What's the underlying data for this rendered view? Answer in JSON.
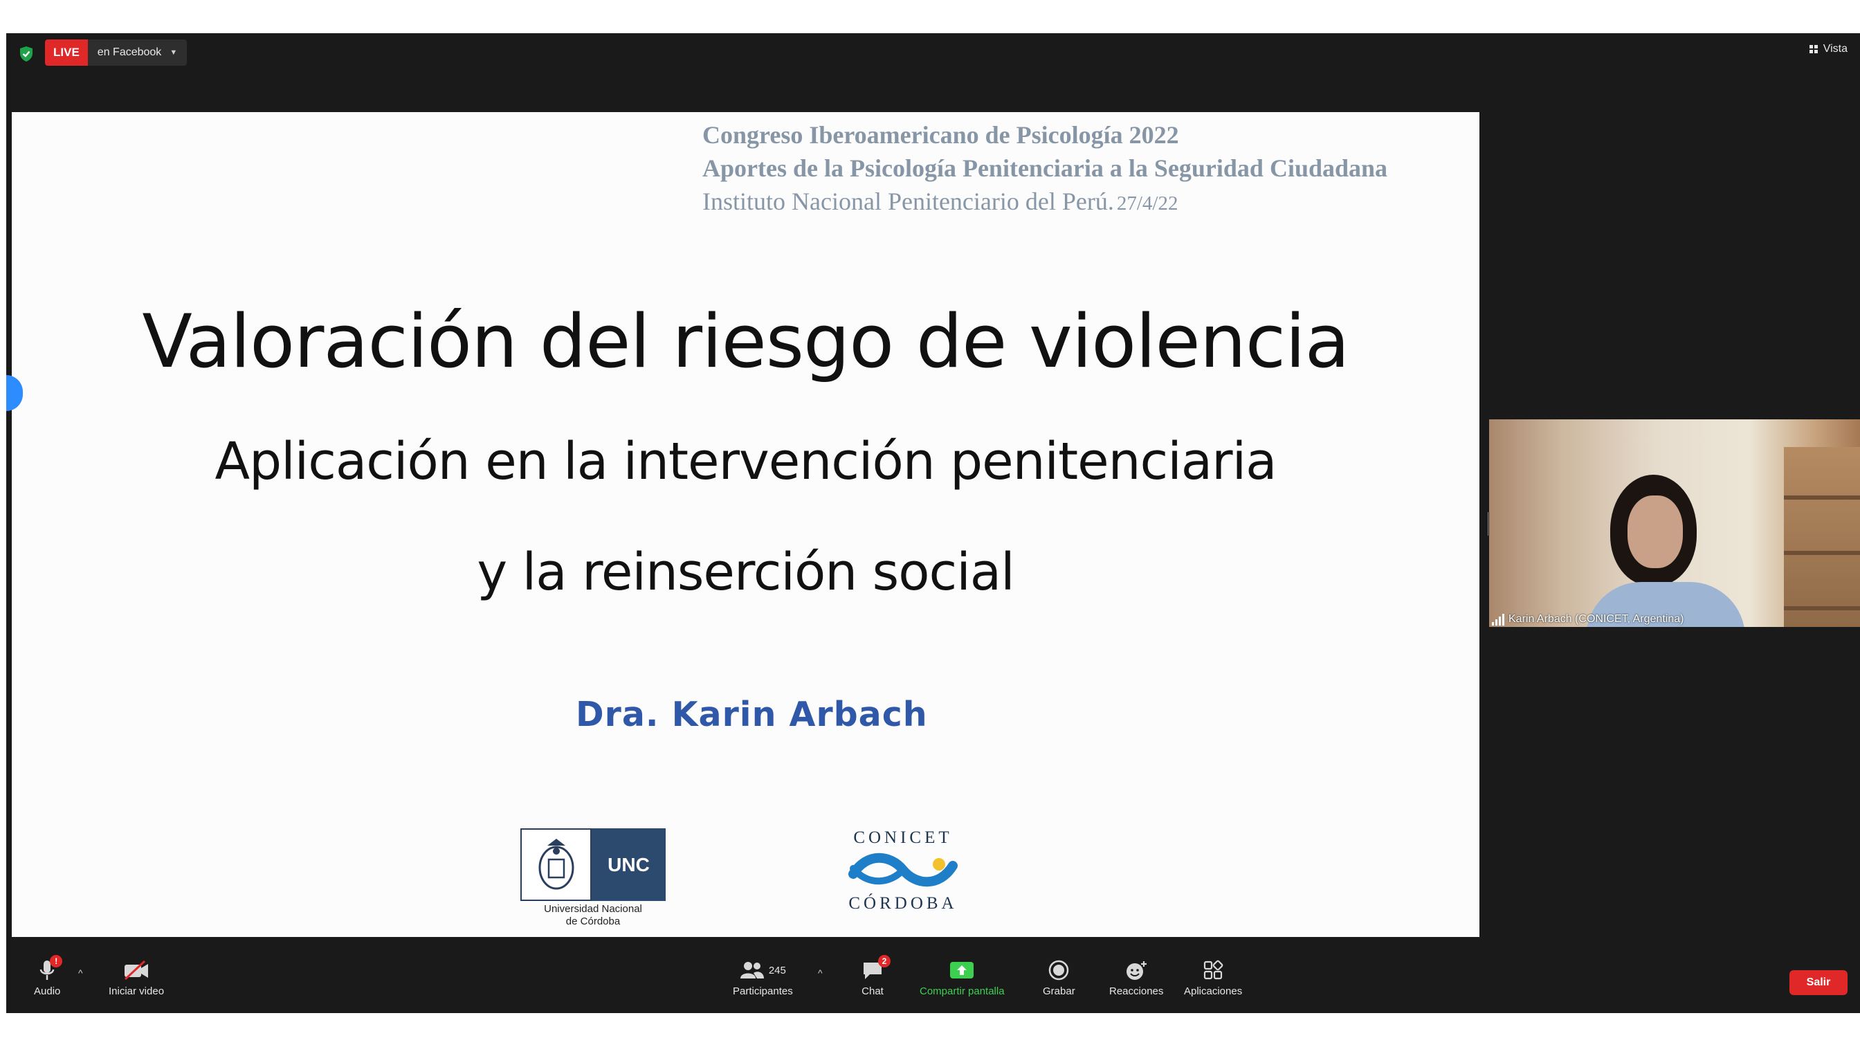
{
  "topbar": {
    "live_label": "LIVE",
    "live_destination": "en Facebook",
    "view_label": "Vista"
  },
  "slide": {
    "conference_line1": "Congreso Iberoamericano de Psicología 2022",
    "conference_line2": "Aportes de la Psicología Penitenciaria a la Seguridad Ciudadana",
    "conference_line3": "Instituto Nacional Penitenciario del Perú.",
    "conference_date": "27/4/22",
    "title": "Valoración del riesgo de violencia",
    "subtitle_line1": "Aplicación en la intervención penitenciaria",
    "subtitle_line2": "y la reinserción social",
    "author": "Dra. Karin Arbach",
    "unc_logo_text": "UNC",
    "unc_caption_line1": "Universidad Nacional",
    "unc_caption_line2": "de Córdoba",
    "conicet_top": "CONICET",
    "conicet_bottom": "CÓRDOBA"
  },
  "video": {
    "participant_name": "Karin Arbach (CONICET, Argentina)"
  },
  "toolbar": {
    "audio_label": "Audio",
    "audio_badge": "!",
    "video_label": "Iniciar video",
    "participants_label": "Participantes",
    "participants_count": "245",
    "chat_label": "Chat",
    "chat_badge": "2",
    "share_label": "Compartir pantalla",
    "record_label": "Grabar",
    "reactions_label": "Reacciones",
    "apps_label": "Aplicaciones",
    "exit_label": "Salir"
  },
  "colors": {
    "live_red": "#e02828",
    "share_green": "#3cd050",
    "author_blue": "#2f58a8",
    "header_gray": "#8796a6"
  }
}
